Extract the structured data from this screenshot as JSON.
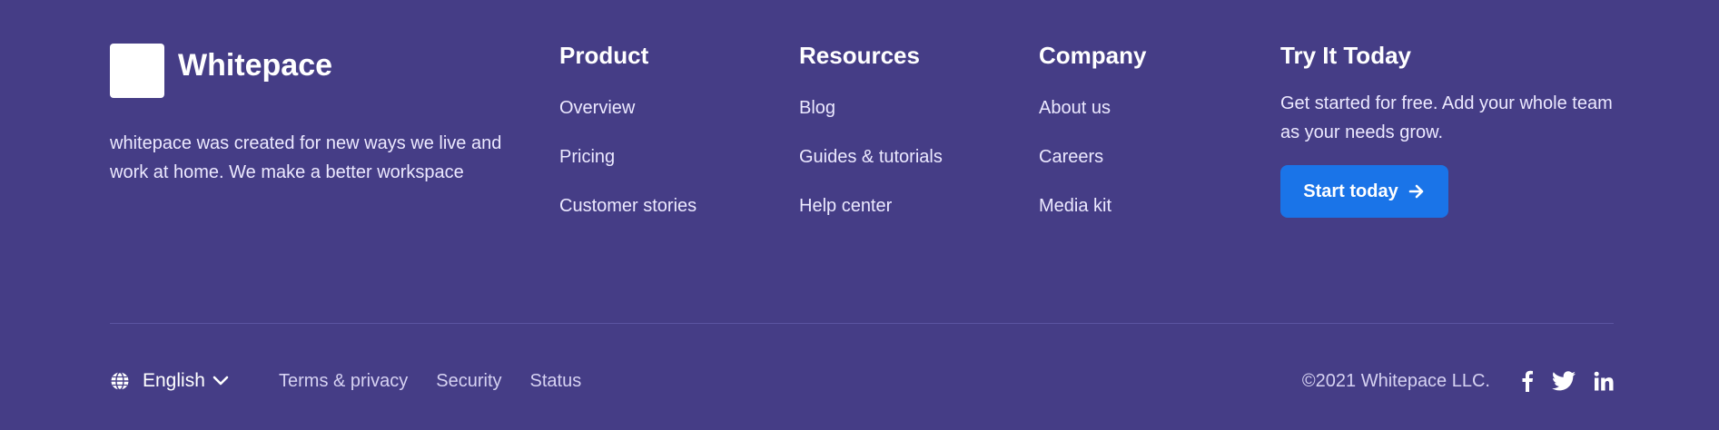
{
  "brand": {
    "name": "Whitepace",
    "description": "whitepace was created for new ways we live and work at home. We make a better workspace"
  },
  "columns": [
    {
      "title": "Product",
      "links": [
        "Overview",
        "Pricing",
        "Customer stories"
      ]
    },
    {
      "title": "Resources",
      "links": [
        "Blog",
        "Guides & tutorials",
        "Help center"
      ]
    },
    {
      "title": "Company",
      "links": [
        "About us",
        "Careers",
        "Media kit"
      ]
    }
  ],
  "try_it": {
    "title": "Try It Today",
    "description": "Get started for free. Add your whole team as your needs grow.",
    "button_label": "Start today",
    "button_icon": "arrow-right-icon"
  },
  "bottom": {
    "language": "English",
    "language_icon": "globe-icon",
    "legal_links": [
      "Terms & privacy",
      "Security",
      "Status"
    ],
    "copyright": "©2021 Whitepace LLC.",
    "social": [
      "facebook-icon",
      "twitter-icon",
      "linkedin-icon"
    ]
  },
  "colors": {
    "background": "#453d86",
    "accent": "#1a74e8",
    "text": "#ffffff"
  }
}
